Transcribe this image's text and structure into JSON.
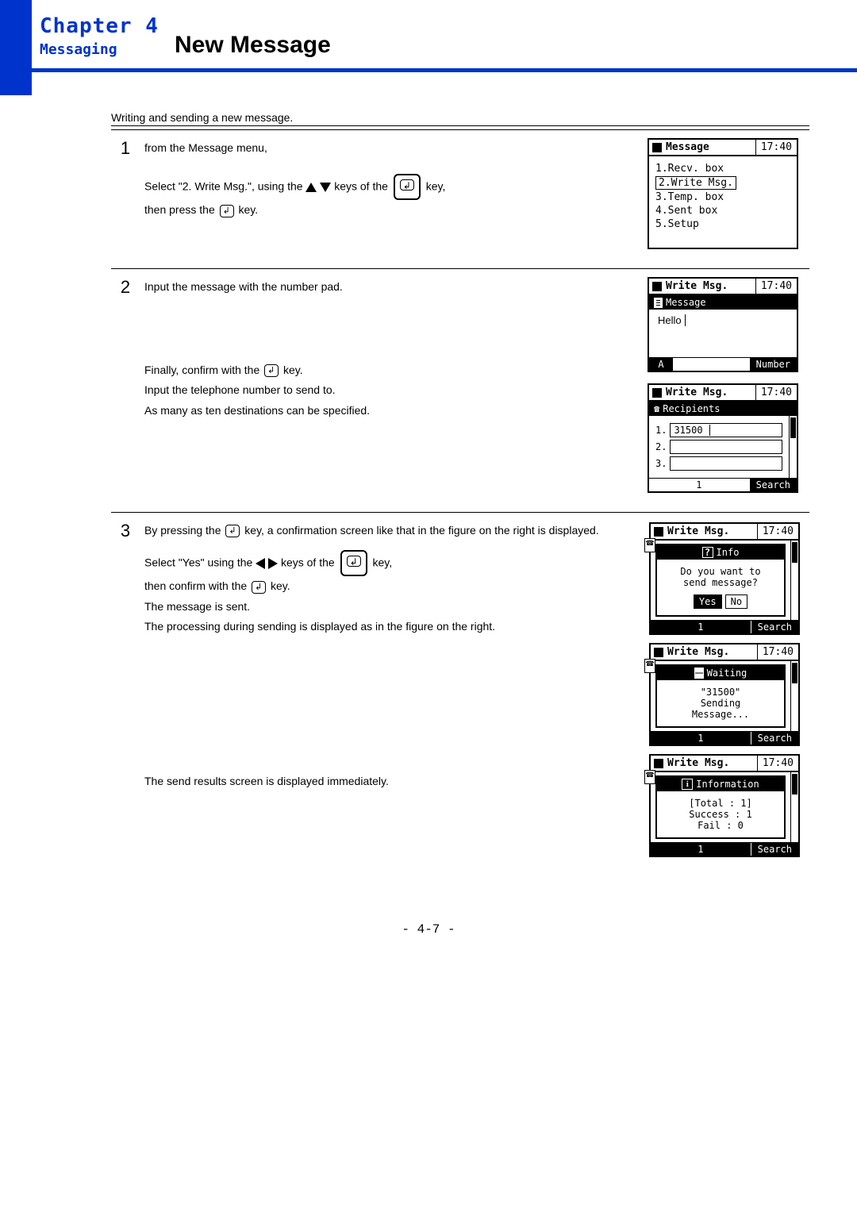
{
  "header": {
    "chapter": "Chapter 4",
    "subtitle": "Messaging",
    "section": "New Message"
  },
  "intro": "Writing and sending a new message.",
  "steps": {
    "s1": {
      "num": "1",
      "l1": "from the Message menu,",
      "l2a": "Select \"2. Write Msg.\", using the ",
      "l2b": " keys of the ",
      "l2c": " key,",
      "l3a": "then press the ",
      "l3b": " key."
    },
    "s2": {
      "num": "2",
      "l1": "Input the message with the number pad.",
      "l2a": "Finally, confirm with the ",
      "l2b": " key.",
      "l3": "Input the telephone number to send to.",
      "l4": "As many as ten destinations can be specified."
    },
    "s3": {
      "num": "3",
      "l1a": "By pressing the ",
      "l1b": " key, a confirmation screen like that in the figure on the right is displayed.",
      "l2a": "Select \"Yes\" using the ",
      "l2b": " keys of the ",
      "l2c": " key,",
      "l3a": "then confirm with the ",
      "l3b": " key.",
      "l4": "The message is sent.",
      "l5": "The processing during sending is displayed as in the figure on the right.",
      "l6": "The send results screen is displayed immediately."
    }
  },
  "screens": {
    "menu": {
      "title": "Message",
      "time": "17:40",
      "items": [
        "1.Recv. box",
        "2.Write Msg.",
        "3.Temp. box",
        "4.Sent box",
        "5.Setup"
      ]
    },
    "write1": {
      "title": "Write Msg.",
      "time": "17:40",
      "sub": "Message",
      "text": "Hello",
      "foot_l": "A",
      "foot_r": "Number"
    },
    "write2": {
      "title": "Write Msg.",
      "time": "17:40",
      "sub": "Recipients",
      "r1n": "1.",
      "r1v": "31500",
      "r2n": "2.",
      "r3n": "3.",
      "foot_l": "1",
      "foot_r": "Search"
    },
    "confirm": {
      "title": "Write Msg.",
      "time": "17:40",
      "head": "Info",
      "q1": "Do you want to",
      "q2": "send message?",
      "yes": "Yes",
      "no": "No",
      "foot_l": "1",
      "foot_r": "Search"
    },
    "waiting": {
      "title": "Write Msg.",
      "time": "17:40",
      "head": "Waiting",
      "l1": "\"31500\"",
      "l2": "Sending",
      "l3": "Message...",
      "foot_l": "1",
      "foot_r": "Search"
    },
    "result": {
      "title": "Write Msg.",
      "time": "17:40",
      "head": "Information",
      "l1": "[Total : 1]",
      "l2": "Success : 1",
      "l3": "Fail : 0",
      "foot_l": "1",
      "foot_r": "Search"
    }
  },
  "footer": "- 4-7 -"
}
